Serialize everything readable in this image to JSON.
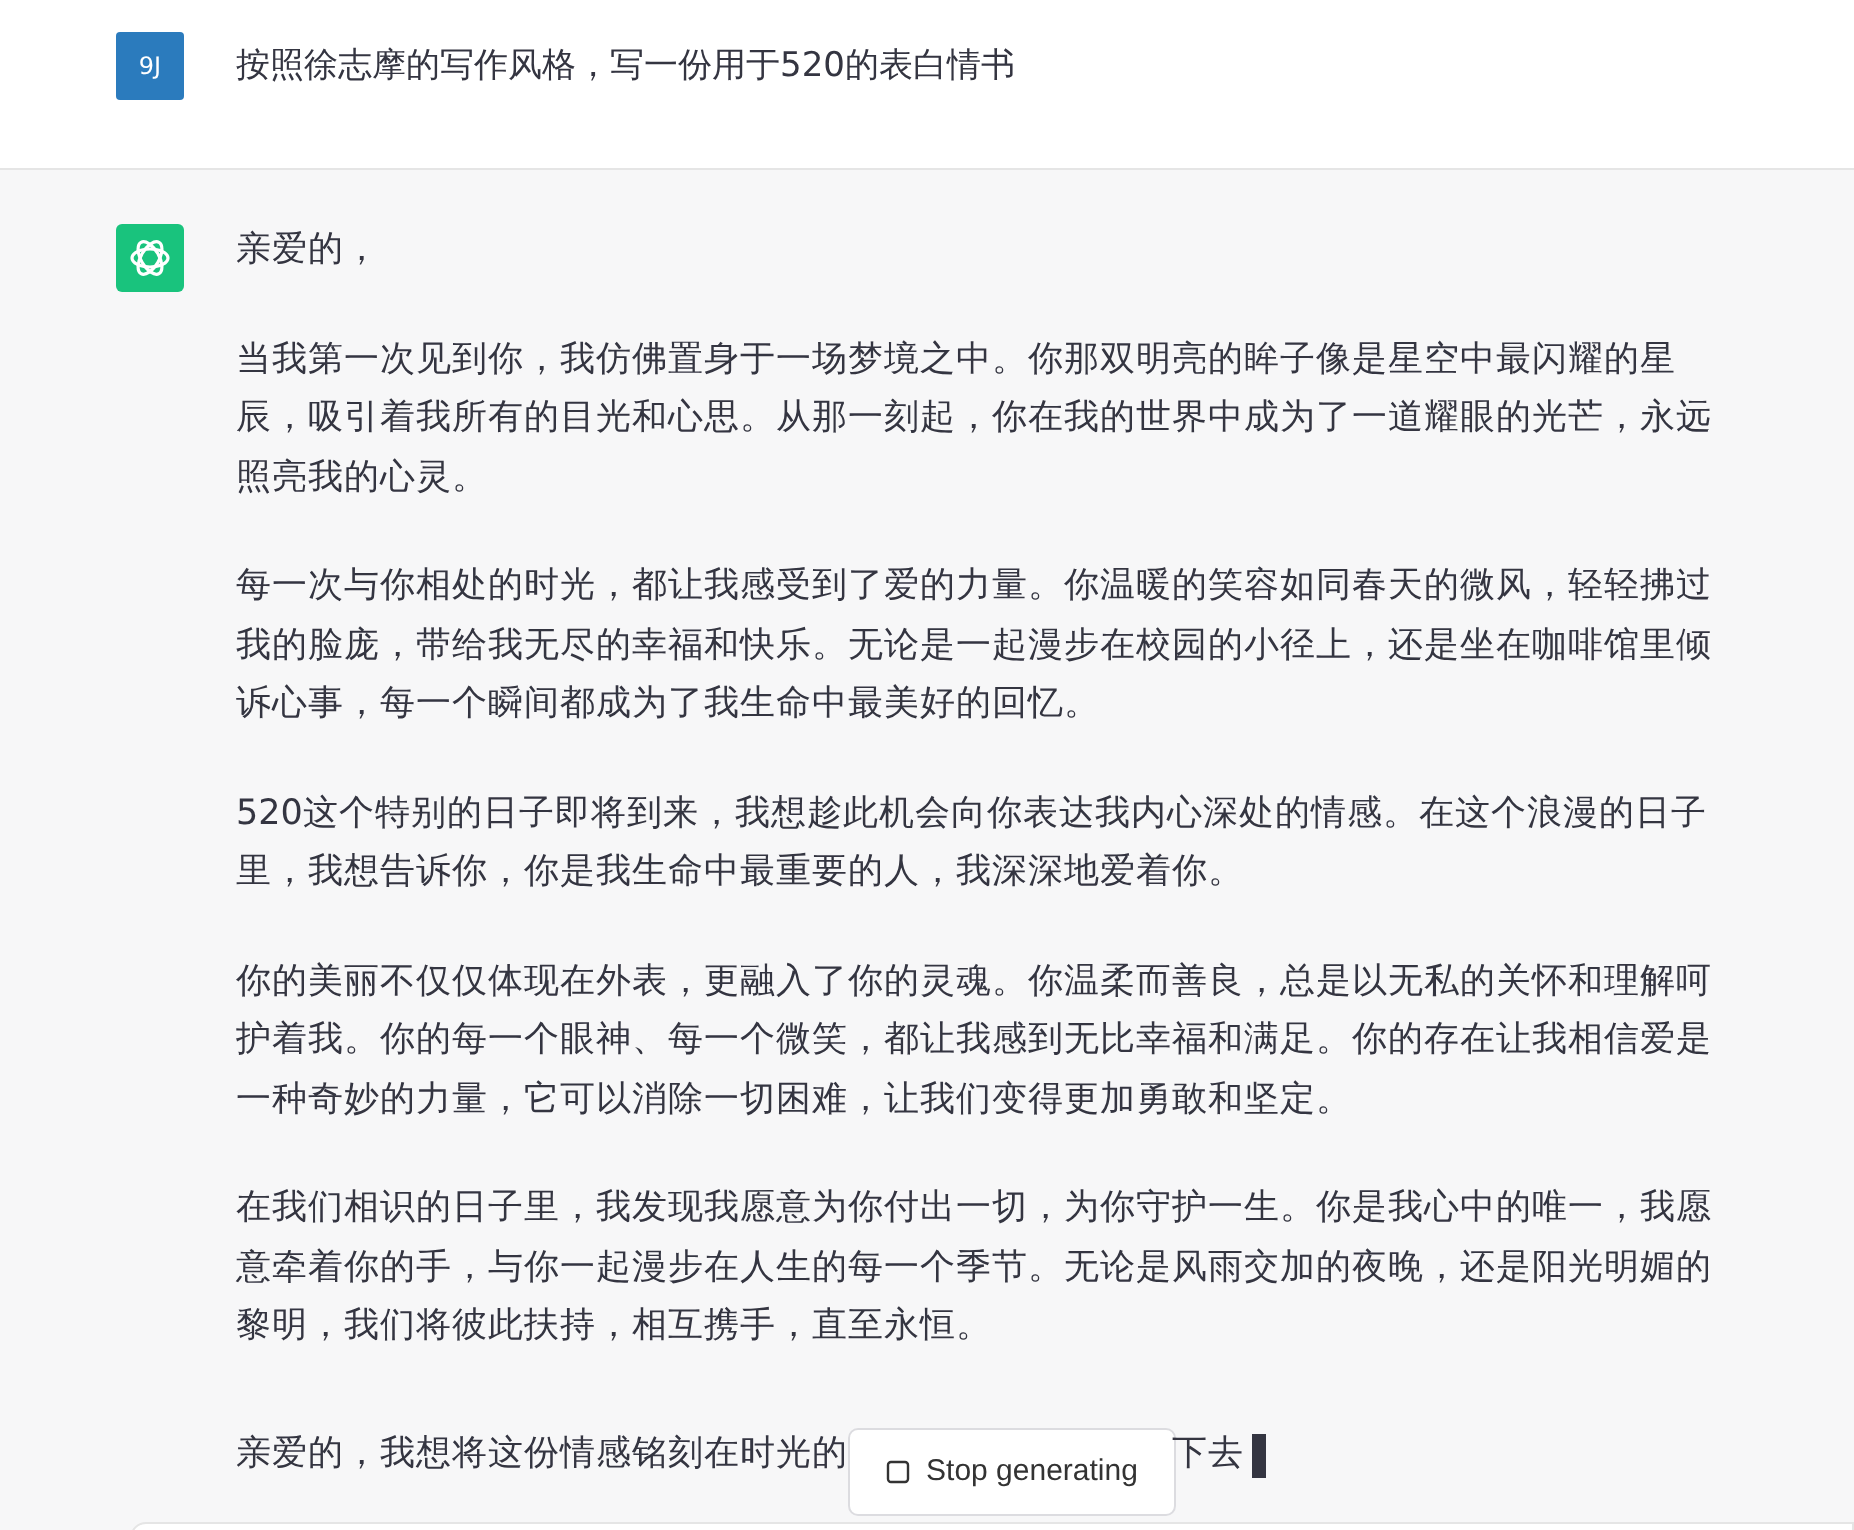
{
  "user_message": {
    "avatar": "9J",
    "text": "按照徐志摩的写作风格，写一份用于520的表白情书"
  },
  "assistant_message": {
    "paragraphs": [
      "亲爱的，",
      "当我第一次见到你，我仿佛置身于一场梦境之中。你那双明亮的眸子像是星空中最闪耀的星辰，吸引着我所有的目光和心思。从那一刻起，你在我的世界中成为了一道耀眼的光芒，永远照亮我的心灵。",
      "每一次与你相处的时光，都让我感受到了爱的力量。你温暖的笑容如同春天的微风，轻轻拂过我的脸庞，带给我无尽的幸福和快乐。无论是一起漫步在校园的小径上，还是坐在咖啡馆里倾诉心事，每一个瞬间都成为了我生命中最美好的回忆。",
      "520这个特别的日子即将到来，我想趁此机会向你表达我内心深处的情感。在这个浪漫的日子里，我想告诉你，你是我生命中最重要的人，我深深地爱着你。",
      "你的美丽不仅仅体现在外表，更融入了你的灵魂。你温柔而善良，总是以无私的关怀和理解呵护着我。你的每一个眼神、每一个微笑，都让我感到无比幸福和满足。你的存在让我相信爱是一种奇妙的力量，它可以消除一切困难，让我们变得更加勇敢和坚定。",
      "在我们相识的日子里，我发现我愿意为你付出一切，为你守护一生。你是我心中的唯一，我愿意牵着你的手，与你一起漫步在人生的每一个季节。无论是风雨交加的夜晚，还是阳光明媚的黎明，我们将彼此扶持，相互携手，直至永恒。"
    ],
    "last_line_before": "亲爱的，我想将这份情感铭刻在时光的",
    "last_line_after": "下去",
    "generating": true
  },
  "stop_button": {
    "label": "Stop generating"
  }
}
